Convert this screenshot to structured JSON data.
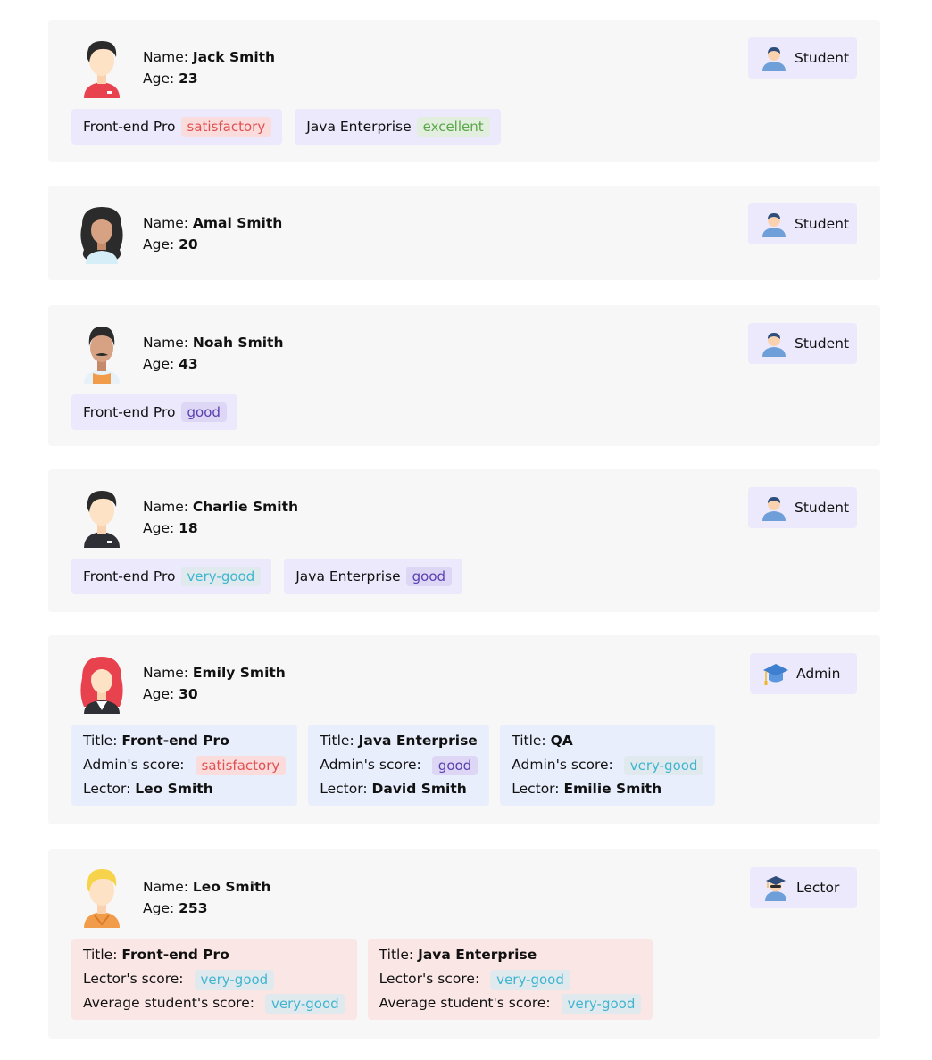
{
  "labels": {
    "name": "Name:",
    "age": "Age:",
    "title": "Title:",
    "admin_score": "Admin's score:",
    "lector": "Lector:",
    "lector_score": "Lector's score:",
    "avg_student_score": "Average student's score:"
  },
  "people": [
    {
      "name": "Jack Smith",
      "age": "23",
      "role": "Student",
      "avatar_icon": "man-red-shirt-avatar-icon",
      "courses": [
        {
          "name": "Front-end Pro",
          "grade": "satisfactory"
        },
        {
          "name": "Java Enterprise",
          "grade": "excellent"
        }
      ]
    },
    {
      "name": "Amal Smith",
      "age": "20",
      "role": "Student",
      "avatar_icon": "woman-curly-hair-avatar-icon",
      "courses": []
    },
    {
      "name": "Noah Smith",
      "age": "43",
      "role": "Student",
      "avatar_icon": "man-mustache-avatar-icon",
      "courses": [
        {
          "name": "Front-end Pro",
          "grade": "good"
        }
      ]
    },
    {
      "name": "Charlie Smith",
      "age": "18",
      "role": "Student",
      "avatar_icon": "man-dark-shirt-avatar-icon",
      "courses": [
        {
          "name": "Front-end Pro",
          "grade": "very-good"
        },
        {
          "name": "Java Enterprise",
          "grade": "good"
        }
      ]
    },
    {
      "name": "Emily Smith",
      "age": "30",
      "role": "Admin",
      "avatar_icon": "woman-red-hair-avatar-icon",
      "admin_courses": [
        {
          "title": "Front-end Pro",
          "score": "satisfactory",
          "lector": "Leo Smith"
        },
        {
          "title": "Java Enterprise",
          "score": "good",
          "lector": "David Smith"
        },
        {
          "title": "QA",
          "score": "very-good",
          "lector": "Emilie Smith"
        }
      ]
    },
    {
      "name": "Leo Smith",
      "age": "253",
      "role": "Lector",
      "avatar_icon": "man-blonde-avatar-icon",
      "lector_courses": [
        {
          "title": "Front-end Pro",
          "score": "very-good",
          "avg": "very-good"
        },
        {
          "title": "Java Enterprise",
          "score": "very-good",
          "avg": "very-good"
        }
      ]
    }
  ],
  "colors": {
    "card_bg": "#f7f7f7",
    "badge_bg": "#ebe9fb",
    "admin_block_bg": "#e9eefc",
    "lector_block_bg": "#fbe6e6",
    "satisfactory": "#e05050",
    "excellent": "#5aa64a",
    "good": "#5a3fb0",
    "very_good": "#3fb5cf"
  }
}
